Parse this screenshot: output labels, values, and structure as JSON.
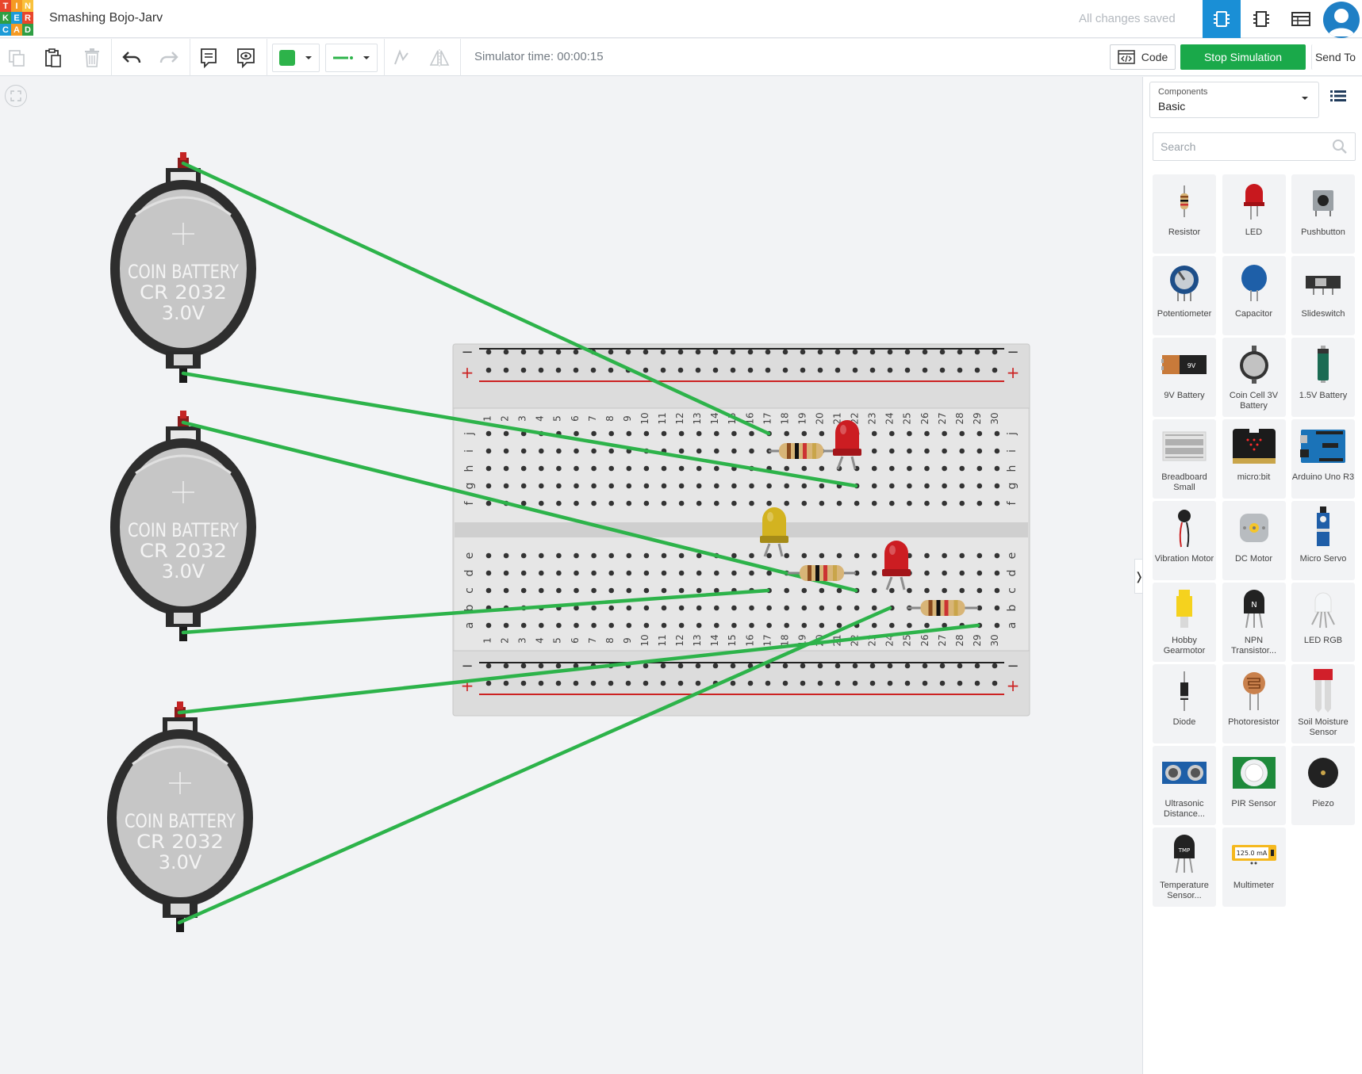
{
  "app": {
    "logo_letters": [
      "T",
      "I",
      "N",
      "K",
      "E",
      "R",
      "C",
      "A",
      "D"
    ],
    "project_title": "Smashing Bojo-Jarv",
    "save_status": "All changes saved"
  },
  "toolbar": {
    "simulator_time": "Simulator time: 00:00:15",
    "code_label": "Code",
    "stop_label": "Stop Simulation",
    "send_label": "Send To",
    "wire_color": "#2db34a"
  },
  "canvas": {
    "batteries": [
      {
        "line1": "COIN BATTERY",
        "line2": "CR 2032",
        "line3": "3.0V"
      },
      {
        "line1": "COIN BATTERY",
        "line2": "CR 2032",
        "line3": "3.0V"
      },
      {
        "line1": "COIN BATTERY",
        "line2": "CR 2032",
        "line3": "3.0V"
      }
    ],
    "breadboard": {
      "columns": 30,
      "top_rows": [
        "j",
        "i",
        "h",
        "g",
        "f"
      ],
      "bottom_rows": [
        "e",
        "d",
        "c",
        "b",
        "a"
      ],
      "minus": "−",
      "plus": "+"
    }
  },
  "panel": {
    "components_label": "Components",
    "components_value": "Basic",
    "search_placeholder": "Search",
    "items": [
      {
        "label": "Resistor",
        "icon": "resistor-icon"
      },
      {
        "label": "LED",
        "icon": "led-icon"
      },
      {
        "label": "Pushbutton",
        "icon": "pushbutton-icon"
      },
      {
        "label": "Potentiometer",
        "icon": "potentiometer-icon"
      },
      {
        "label": "Capacitor",
        "icon": "capacitor-icon"
      },
      {
        "label": "Slideswitch",
        "icon": "slideswitch-icon"
      },
      {
        "label": "9V Battery",
        "icon": "9v-battery-icon"
      },
      {
        "label": "Coin Cell 3V Battery",
        "icon": "coin-cell-icon"
      },
      {
        "label": "1.5V Battery",
        "icon": "aa-battery-icon"
      },
      {
        "label": "Breadboard Small",
        "icon": "breadboard-icon"
      },
      {
        "label": "micro:bit",
        "icon": "microbit-icon"
      },
      {
        "label": "Arduino Uno R3",
        "icon": "arduino-icon"
      },
      {
        "label": "Vibration Motor",
        "icon": "vibration-motor-icon"
      },
      {
        "label": "DC Motor",
        "icon": "dc-motor-icon"
      },
      {
        "label": "Micro Servo",
        "icon": "micro-servo-icon"
      },
      {
        "label": "Hobby Gearmotor",
        "icon": "gearmotor-icon"
      },
      {
        "label": "NPN Transistor...",
        "icon": "npn-transistor-icon"
      },
      {
        "label": "LED RGB",
        "icon": "led-rgb-icon"
      },
      {
        "label": "Diode",
        "icon": "diode-icon"
      },
      {
        "label": "Photoresistor",
        "icon": "photoresistor-icon"
      },
      {
        "label": "Soil Moisture Sensor",
        "icon": "soil-moisture-icon"
      },
      {
        "label": "Ultrasonic Distance...",
        "icon": "ultrasonic-icon"
      },
      {
        "label": "PIR Sensor",
        "icon": "pir-sensor-icon"
      },
      {
        "label": "Piezo",
        "icon": "piezo-icon"
      },
      {
        "label": "Temperature Sensor...",
        "icon": "temperature-sensor-icon"
      },
      {
        "label": "Multimeter",
        "icon": "multimeter-icon",
        "reading": "125.0 mA"
      }
    ]
  }
}
